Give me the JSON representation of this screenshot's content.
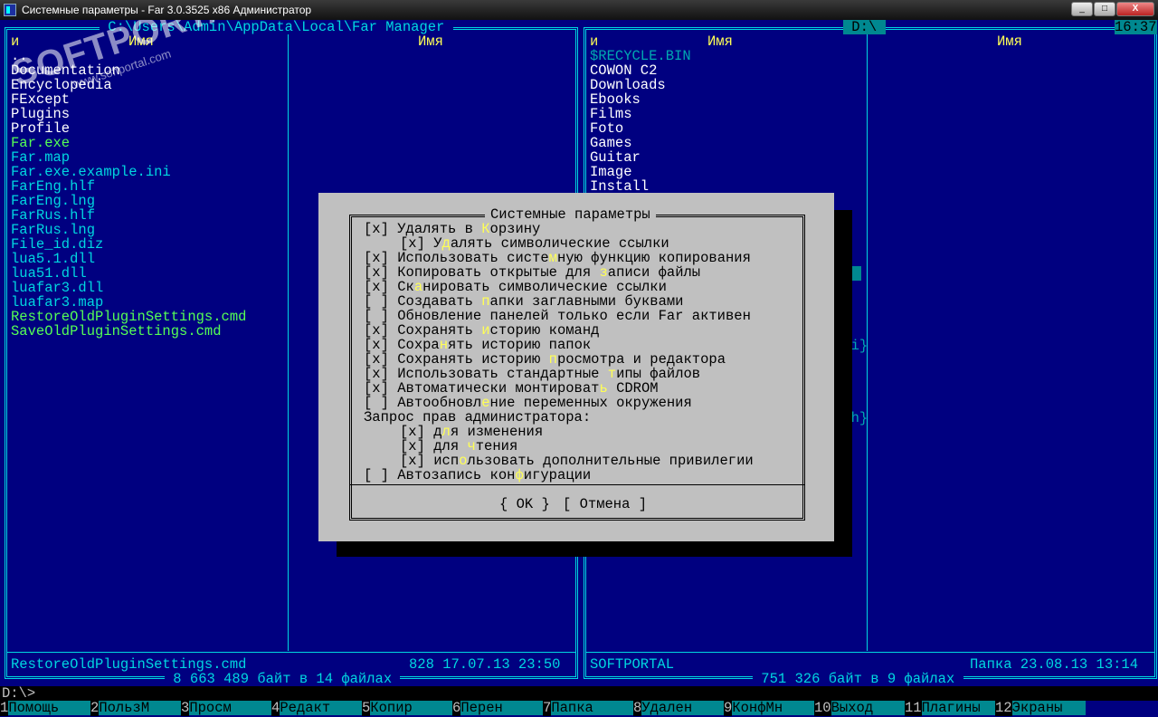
{
  "window": {
    "title": "Системные параметры - Far 3.0.3525 x86 Администратор",
    "min_label": "_",
    "max_label": "□",
    "close_label": "X"
  },
  "left_panel": {
    "path": " C:\\Users\\Admin\\AppData\\Local\\Far Manager ",
    "col_headers": [
      "и",
      "Имя",
      "Имя"
    ],
    "files": [
      {
        "name": "..",
        "kind": "dir"
      },
      {
        "name": "Documentation",
        "kind": "dir"
      },
      {
        "name": "Encyclopedia",
        "kind": "dir"
      },
      {
        "name": "FExcept",
        "kind": "dir"
      },
      {
        "name": "Plugins",
        "kind": "dir"
      },
      {
        "name": "Profile",
        "kind": "dir"
      },
      {
        "name": "Far.exe",
        "kind": "exe"
      },
      {
        "name": "Far.map",
        "kind": "file"
      },
      {
        "name": "Far.exe.example.ini",
        "kind": "file"
      },
      {
        "name": "FarEng.hlf",
        "kind": "file"
      },
      {
        "name": "FarEng.lng",
        "kind": "file"
      },
      {
        "name": "FarRus.hlf",
        "kind": "file"
      },
      {
        "name": "FarRus.lng",
        "kind": "file"
      },
      {
        "name": "File_id.diz",
        "kind": "file"
      },
      {
        "name": "lua5.1.dll",
        "kind": "file"
      },
      {
        "name": "lua51.dll",
        "kind": "file"
      },
      {
        "name": "luafar3.dll",
        "kind": "file"
      },
      {
        "name": "luafar3.map",
        "kind": "file"
      },
      {
        "name": "RestoreOldPluginSettings.cmd",
        "kind": "exe"
      },
      {
        "name": "SaveOldPluginSettings.cmd",
        "kind": "exe"
      }
    ],
    "status_name": "RestoreOldPluginSettings.cmd",
    "status_info": "828 17.07.13 23:50",
    "summary": " 8 663 489 байт в 14 файлах "
  },
  "right_panel": {
    "path": " D:\\ ",
    "clock": "16:37",
    "col_headers": [
      "и",
      "Имя",
      "Имя"
    ],
    "files": [
      {
        "name": "$RECYCLE.BIN",
        "kind": "hidden"
      },
      {
        "name": "COWON C2",
        "kind": "dir"
      },
      {
        "name": "Downloads",
        "kind": "dir"
      },
      {
        "name": "Ebooks",
        "kind": "dir"
      },
      {
        "name": "Films",
        "kind": "dir"
      },
      {
        "name": "Foto",
        "kind": "dir"
      },
      {
        "name": "Games",
        "kind": "dir"
      },
      {
        "name": "Guitar",
        "kind": "dir"
      },
      {
        "name": "Image",
        "kind": "dir"
      },
      {
        "name": "Install",
        "kind": "dir"
      }
    ],
    "partial_fragments": [
      "mbi}",
      ".ch}"
    ],
    "status_name": "SOFTPORTAL",
    "status_info": "Папка 23.08.13 13:14",
    "summary": " 751 326 байт в 9 файлах "
  },
  "dialog": {
    "title": "Системные параметры",
    "options": [
      {
        "mark": "[x]",
        "pre": "Удалять в ",
        "hot": "К",
        "post": "орзину",
        "indent": 0
      },
      {
        "mark": "[x]",
        "pre": "У",
        "hot": "д",
        "post": "алять символические ссылки",
        "indent": 1
      },
      {
        "mark": "[x]",
        "pre": "Использовать систе",
        "hot": "м",
        "post": "ную функцию копирования",
        "indent": 0
      },
      {
        "mark": "[x]",
        "pre": "Копировать открытые для ",
        "hot": "з",
        "post": "аписи файлы",
        "indent": 0
      },
      {
        "mark": "[x]",
        "pre": "Ск",
        "hot": "а",
        "post": "нировать символические ссылки",
        "indent": 0
      },
      {
        "mark": "[ ]",
        "pre": "Создавать ",
        "hot": "п",
        "post": "апки заглавными буквами",
        "indent": 0
      },
      {
        "mark": "[ ]",
        "pre": "Обновление панелей только если Far активен",
        "hot": "",
        "post": "",
        "indent": 0
      },
      {
        "mark": "[x]",
        "pre": "Сохранять ",
        "hot": "и",
        "post": "сторию команд",
        "indent": 0
      },
      {
        "mark": "[x]",
        "pre": "Сохра",
        "hot": "н",
        "post": "ять историю папок",
        "indent": 0
      },
      {
        "mark": "[x]",
        "pre": "Сохранять историю ",
        "hot": "п",
        "post": "росмотра и редактора",
        "indent": 0
      },
      {
        "mark": "[x]",
        "pre": "Использовать стандартные ",
        "hot": "т",
        "post": "ипы файлов",
        "indent": 0
      },
      {
        "mark": "[x]",
        "pre": "Автоматически монтироват",
        "hot": "ь",
        "post": " CDROM",
        "indent": 0
      },
      {
        "mark": "[ ]",
        "pre": "Автообновл",
        "hot": "е",
        "post": "ние переменных окружения",
        "indent": 0
      }
    ],
    "admin_label": "Запрос прав администратора:",
    "admin_options": [
      {
        "mark": "[x]",
        "pre": "д",
        "hot": "л",
        "post": "я изменения"
      },
      {
        "mark": "[x]",
        "pre": "для ",
        "hot": "ч",
        "post": "тения"
      },
      {
        "mark": "[x]",
        "pre": "исп",
        "hot": "о",
        "post": "льзовать дополнительные привилегии"
      }
    ],
    "autosave": {
      "mark": "[ ]",
      "pre": "Автозапись кон",
      "hot": "ф",
      "post": "игурации"
    },
    "ok_label": "{ OK }",
    "cancel_label": "[ Отмена ]"
  },
  "command_line": {
    "prompt": "D:\\>",
    "value": ""
  },
  "keybar": [
    {
      "num": "1",
      "label": "Помощь"
    },
    {
      "num": "2",
      "label": "ПользМ"
    },
    {
      "num": "3",
      "label": "Просм"
    },
    {
      "num": "4",
      "label": "Редакт"
    },
    {
      "num": "5",
      "label": "Копир"
    },
    {
      "num": "6",
      "label": "Перен"
    },
    {
      "num": "7",
      "label": "Папка"
    },
    {
      "num": "8",
      "label": "Удален"
    },
    {
      "num": "9",
      "label": "КонфМн"
    },
    {
      "num": "10",
      "label": "Выход"
    },
    {
      "num": "11",
      "label": "Плагины"
    },
    {
      "num": "12",
      "label": "Экраны"
    }
  ],
  "watermark": {
    "big": "SOFTPORTAL",
    "small": "www.softportal.com"
  },
  "colors": {
    "console_bg": "#000080",
    "frame": "#00d7e0",
    "dir": "#ffffff",
    "file": "#00d7e0",
    "exe": "#55ff55",
    "header": "#ffff55",
    "dialog_bg": "#c0c0c0",
    "keybar_bg": "#008890"
  }
}
